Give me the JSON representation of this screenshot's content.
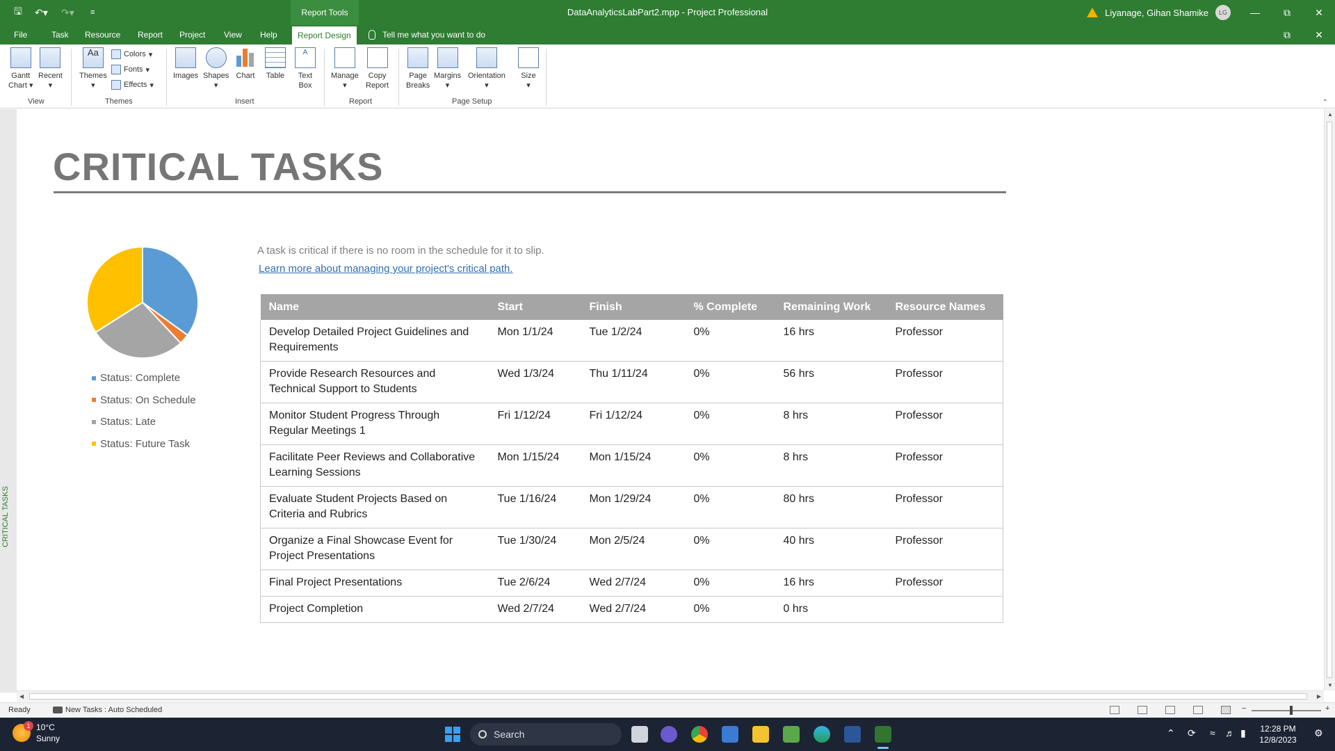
{
  "titlebar": {
    "report_tools": "Report Tools",
    "doc_title": "DataAnalyticsLabPart2.mpp  -  Project Professional",
    "user_name": "Liyanage, Gihan Shamike",
    "avatar_initials": "LG"
  },
  "menu": {
    "tabs": [
      "File",
      "Task",
      "Resource",
      "Report",
      "Project",
      "View",
      "Help",
      "Report Design"
    ],
    "tell_me": "Tell me what you want to do"
  },
  "ribbon": {
    "gantt_chart": "Gantt\nChart",
    "gantt_l1": "Gantt",
    "gantt_l2": "Chart",
    "recent": "Recent",
    "themes": "Themes",
    "colors": "Colors",
    "fonts": "Fonts",
    "effects": "Effects",
    "images": "Images",
    "shapes": "Shapes",
    "chart": "Chart",
    "table": "Table",
    "textbox_l1": "Text",
    "textbox_l2": "Box",
    "manage": "Manage",
    "copy_l1": "Copy",
    "copy_l2": "Report",
    "pagebreaks_l1": "Page",
    "pagebreaks_l2": "Breaks",
    "margins": "Margins",
    "orientation": "Orientation",
    "size": "Size",
    "groups": [
      "View",
      "Themes",
      "Insert",
      "Report",
      "Page Setup"
    ]
  },
  "sidebar_label": "CRITICAL TASKS",
  "report": {
    "title": "CRITICAL TASKS",
    "description": "A task is critical if there is no room in the schedule for it to slip.",
    "link": "Learn more about managing your project's critical path."
  },
  "chart_data": {
    "type": "pie",
    "series": [
      {
        "name": "Status: Complete",
        "value": 35,
        "color": "#5b9bd5"
      },
      {
        "name": "Status: On Schedule",
        "value": 3,
        "color": "#ed7d31"
      },
      {
        "name": "Status: Late",
        "value": 28,
        "color": "#a5a5a5"
      },
      {
        "name": "Status: Future Task",
        "value": 34,
        "color": "#ffc000"
      }
    ]
  },
  "table": {
    "headers": [
      "Name",
      "Start",
      "Finish",
      "% Complete",
      "Remaining Work",
      "Resource Names"
    ],
    "rows": [
      [
        "Develop Detailed Project Guidelines and Requirements",
        "Mon 1/1/24",
        "Tue 1/2/24",
        "0%",
        "16 hrs",
        "Professor"
      ],
      [
        "Provide Research Resources and Technical Support to Students",
        "Wed 1/3/24",
        "Thu 1/11/24",
        "0%",
        "56 hrs",
        "Professor"
      ],
      [
        "Monitor Student Progress Through Regular Meetings 1",
        "Fri 1/12/24",
        "Fri 1/12/24",
        "0%",
        "8 hrs",
        "Professor"
      ],
      [
        "Facilitate Peer Reviews and Collaborative Learning Sessions",
        "Mon 1/15/24",
        "Mon 1/15/24",
        "0%",
        "8 hrs",
        "Professor"
      ],
      [
        "Evaluate Student Projects Based on Criteria and Rubrics",
        "Tue 1/16/24",
        "Mon 1/29/24",
        "0%",
        "80 hrs",
        "Professor"
      ],
      [
        "Organize a Final Showcase Event for Project Presentations",
        "Tue 1/30/24",
        "Mon 2/5/24",
        "0%",
        "40 hrs",
        "Professor"
      ],
      [
        "Final Project Presentations",
        "Tue 2/6/24",
        "Wed 2/7/24",
        "0%",
        "16 hrs",
        "Professor"
      ],
      [
        "Project Completion",
        "Wed 2/7/24",
        "Wed 2/7/24",
        "0%",
        "0 hrs",
        ""
      ]
    ]
  },
  "status": {
    "ready": "Ready",
    "new_tasks": "New Tasks : Auto Scheduled"
  },
  "taskbar": {
    "temp": "10°C",
    "weather": "Sunny",
    "weather_badge": "1",
    "search": "Search",
    "time": "12:28 PM",
    "date": "12/8/2023"
  },
  "colors": {
    "accent_green": "#2e7d32",
    "table_header": "#a5a5a5",
    "link_blue": "#2e6fb4"
  }
}
